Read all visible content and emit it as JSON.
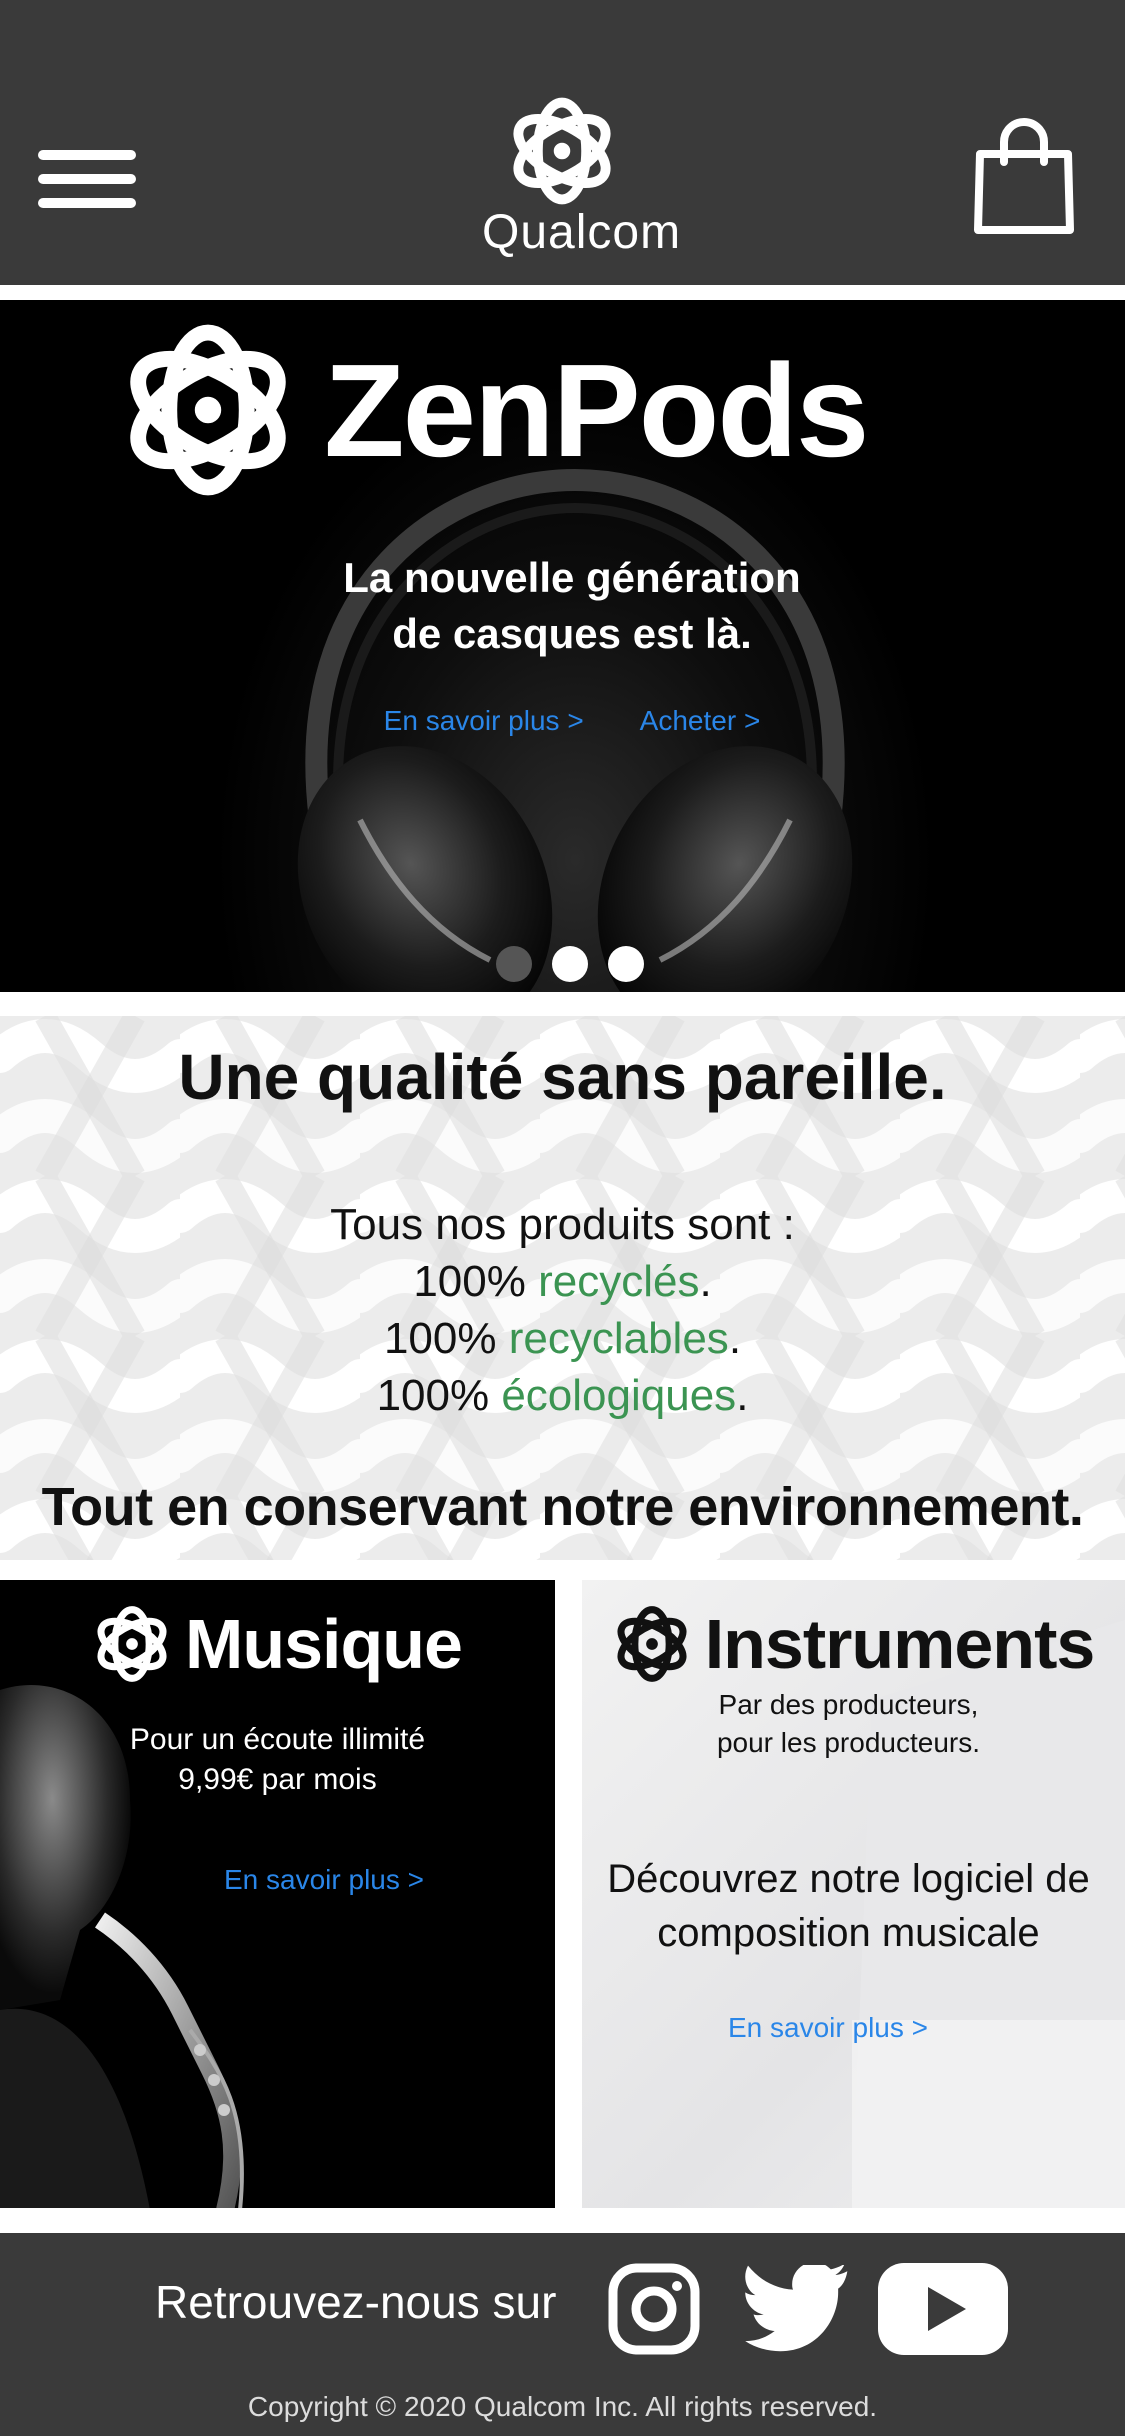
{
  "header": {
    "menu_icon": "hamburger-menu-icon",
    "brand": "Qualcom",
    "cart_icon": "shopping-bag-icon"
  },
  "hero": {
    "product": "ZenPods",
    "tagline_line1": "La nouvelle génération",
    "tagline_line2": "de casques est là.",
    "learn_more": "En savoir plus >",
    "buy": "Acheter >",
    "carousel": {
      "total": 3,
      "active_index": 0
    }
  },
  "quality": {
    "title": "Une qualité sans pareille.",
    "intro": "Tous nos produits sont :",
    "lines": [
      {
        "prefix": "100% ",
        "highlight": "recyclés",
        "suffix": "."
      },
      {
        "prefix": "100% ",
        "highlight": "recyclables",
        "suffix": "."
      },
      {
        "prefix": "100% ",
        "highlight": "écologiques",
        "suffix": "."
      }
    ],
    "footer": "Tout en conservant notre environnement."
  },
  "music": {
    "title": "Musique",
    "line1": "Pour un écoute illimité",
    "line2": "9,99€ par mois",
    "link": "En savoir plus >"
  },
  "instruments": {
    "title": "Instruments",
    "sub1": "Par des producteurs,",
    "sub2": "pour les producteurs.",
    "desc1": "Découvrez notre logiciel de",
    "desc2": "composition musicale",
    "link": "En savoir plus >"
  },
  "footer": {
    "follow": "Retrouvez-nous sur",
    "social": [
      "instagram-icon",
      "twitter-icon",
      "youtube-icon"
    ],
    "copyright": "Copyright © 2020 Qualcom Inc. All rights reserved."
  },
  "colors": {
    "header_bg": "#3a3a3a",
    "link_blue": "#2a86e8",
    "eco_green": "#3b9452"
  }
}
